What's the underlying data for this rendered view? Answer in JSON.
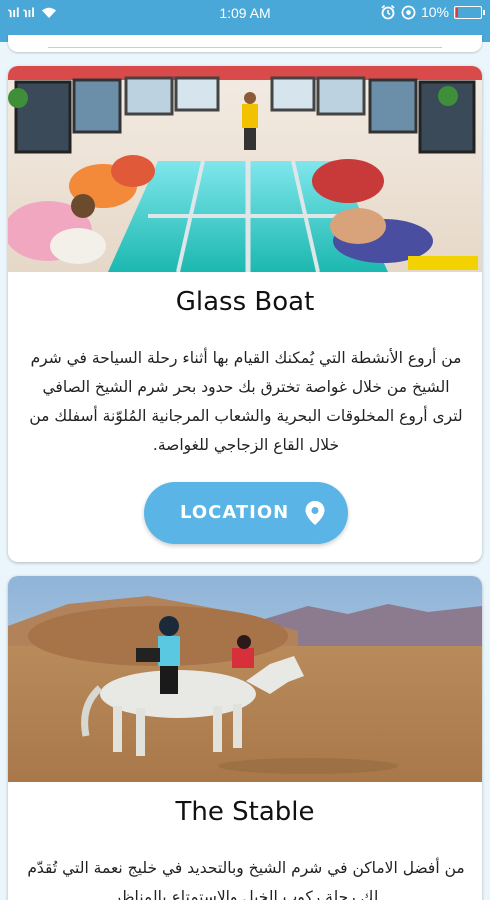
{
  "status_bar": {
    "signal": "ℵıl ℵıl",
    "time": "1:09 AM",
    "battery_percent": "10%",
    "battery_level": 0.1
  },
  "cards": [
    {
      "title": "Glass Boat",
      "description": "من أروع الأنشطة التي يُمكنك القيام بها أثناء رحلة السياحة في شرم الشيخ من خلال غواصة تخترق بك حدود بحر شرم الشيخ الصافي لترى أروع المخلوقات البحرية والشعاب المرجانية المُلوّنة أسفلك من خلال القاع الزجاجي للغواصة.",
      "button_label": "LOCATION"
    },
    {
      "title": "The Stable",
      "description": "من أفضل الاماكن في شرم الشيخ وبالتحديد في خليج نعمة التي تُقدّم لك رحلة ركوب الخيل والإستمتاع بالمناظر"
    }
  ],
  "colors": {
    "accent": "#4aa8d8",
    "button": "#5ab4e5",
    "background": "#eaf6fb"
  },
  "icons": {
    "wifi": "wifi-icon",
    "alarm": "alarm-icon",
    "location": "location-pin-icon"
  }
}
